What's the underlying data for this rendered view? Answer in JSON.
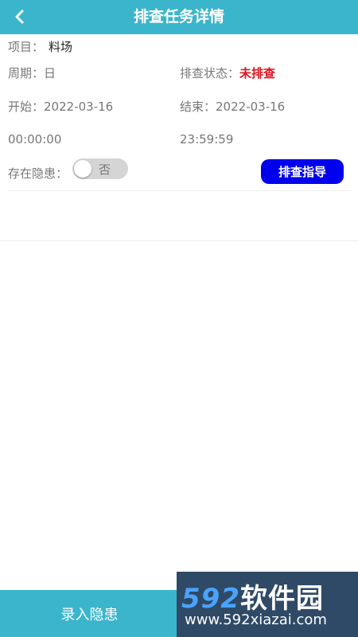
{
  "header": {
    "title": "排查任务详情",
    "back_icon": "chevron-left-icon"
  },
  "details": {
    "project_label": "项目：",
    "project_value": "料场",
    "cycle_label": "周期：",
    "cycle_value": "日",
    "status_label": "排查状态：",
    "status_value": "未排查",
    "status_color": "#e0141e",
    "start_label": "开始：",
    "start_date": "2022-03-16",
    "start_time": "00:00:00",
    "end_label": "结束：",
    "end_date": "2022-03-16",
    "end_time": "23:59:59",
    "hazard_label": "存在隐患：",
    "hazard_toggle_text": "否",
    "hazard_on": false
  },
  "guide_button": {
    "label": "排查指导",
    "color": "#0000ee"
  },
  "bottom_bar": {
    "record_label": "录入隐患",
    "color": "#3bb5cc"
  },
  "watermark": {
    "logo_num": "592",
    "logo_text": "软件园",
    "url": "www.592xiazai.com"
  }
}
